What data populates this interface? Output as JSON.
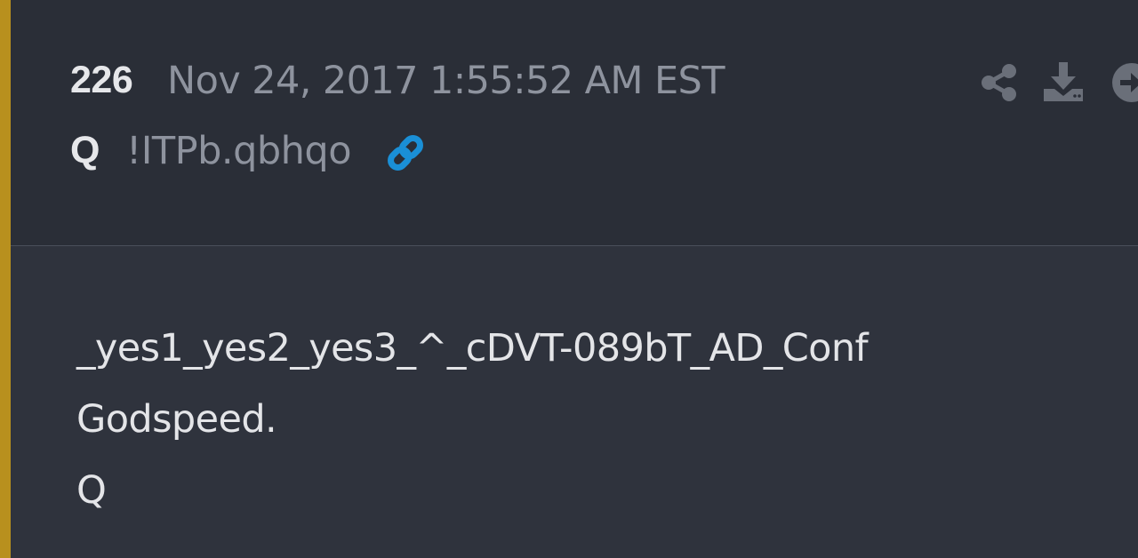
{
  "post": {
    "number": "226",
    "timestamp": "Nov 24, 2017 1:55:52 AM EST",
    "author": "Q",
    "tripcode": "!ITPb.qbhqo",
    "body_lines": [
      "_yes1_yes2_yes3_^_cDVT-089bT_AD_Conf",
      "Godspeed.",
      "Q"
    ]
  },
  "icons": {
    "link": "link-icon",
    "share": "share-icon",
    "download": "download-icon",
    "forward": "forward-icon"
  },
  "colors": {
    "accent": "#b8901e",
    "header_bg": "#2a2e37",
    "body_bg": "#2f333d",
    "link_icon": "#1a8fd6",
    "muted_text": "#8e939e",
    "primary_text": "#e6e7ea"
  }
}
